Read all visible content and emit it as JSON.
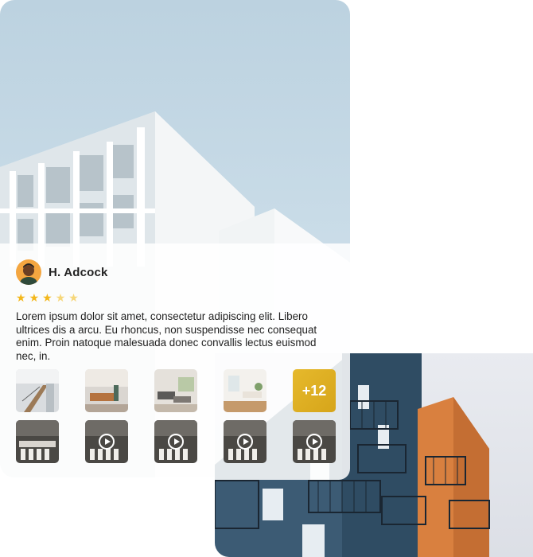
{
  "reviewer": {
    "name": "H. Adcock",
    "rating": 3,
    "max_rating": 5
  },
  "review": {
    "text": "Lorem ipsum dolor sit amet, consectetur adipiscing elit. Libero ultrices dis a arcu. Eu rhoncus, non suspendisse nec consequat enim. Proin natoque malesuada donec convallis lectus euismod nec, in."
  },
  "gallery": {
    "photos": [
      "photo-staircase",
      "photo-living-room",
      "photo-lounge",
      "photo-bright-room"
    ],
    "more_label": "+12",
    "videos": [
      "video-1",
      "video-2",
      "video-3",
      "video-4",
      "video-5"
    ]
  },
  "colors": {
    "star_on": "#f3b71b",
    "star_off": "#f6d77a",
    "more_tile": "#dcae22",
    "avatar_bg": "#f4a640"
  },
  "icons": {
    "star": "star-icon",
    "play": "play-icon"
  }
}
